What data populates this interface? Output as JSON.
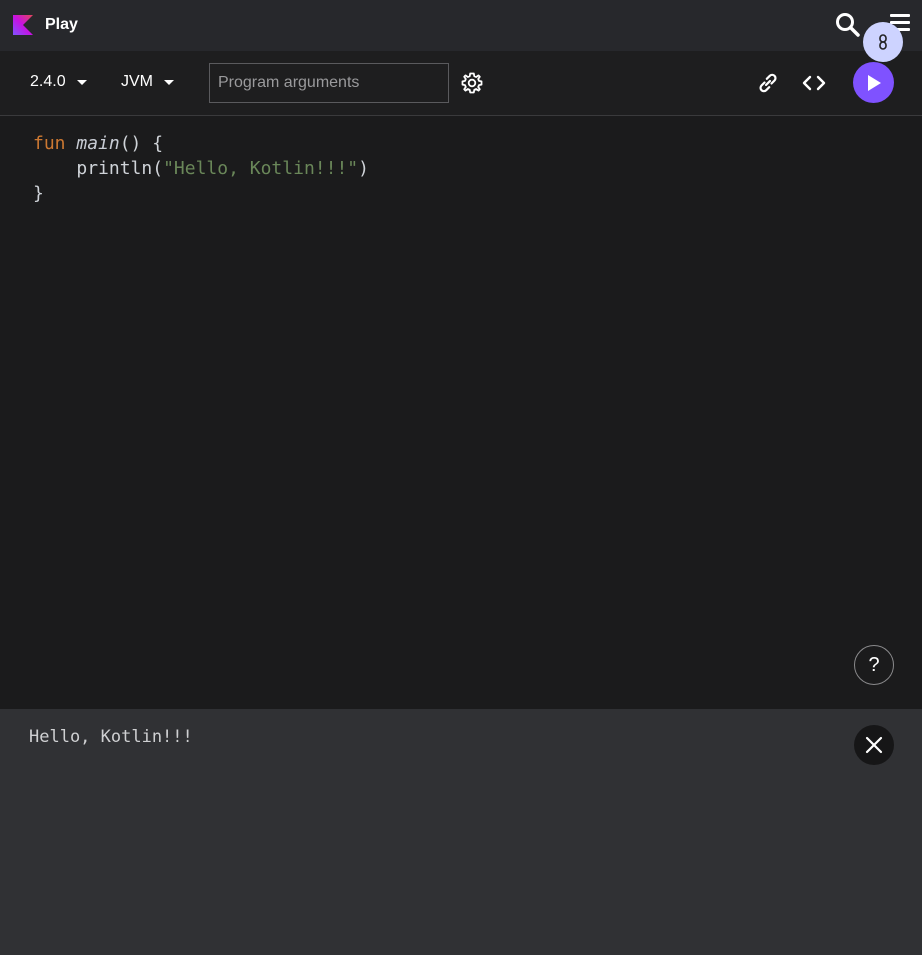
{
  "header": {
    "brand": "Play",
    "logo_icon": "kotlin-logo",
    "search_icon": "search-icon",
    "menu_icon": "hamburger-menu-icon"
  },
  "toolbar": {
    "version": "2.4.0",
    "platform": "JVM",
    "args_placeholder": "Program arguments",
    "args_value": "",
    "settings_icon": "gear-icon",
    "share_icon": "link-icon",
    "embed_icon": "code-brackets-icon",
    "run_icon": "play-icon"
  },
  "editor": {
    "lines": [
      {
        "kw": "fun",
        "name": "main",
        "rest": "() {"
      },
      {
        "indent": "    ",
        "call": "println(",
        "string": "\"Hello, Kotlin!!!\"",
        "close": ")"
      },
      {
        "text": "}"
      }
    ],
    "help_label": "?"
  },
  "console": {
    "output": "Hello, Kotlin!!!",
    "close_icon": "close-icon"
  },
  "colors": {
    "accent": "#7f52ff",
    "keyword": "#cc7832",
    "string": "#6a8759"
  }
}
